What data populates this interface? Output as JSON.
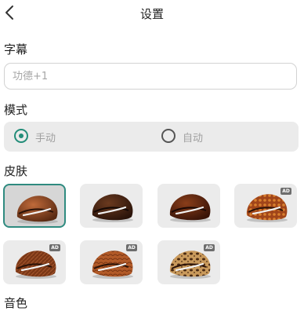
{
  "header": {
    "title": "设置",
    "back_icon": "chevron-left-icon"
  },
  "subtitle_section": {
    "label": "字幕",
    "placeholder": "功德+1"
  },
  "mode_section": {
    "label": "模式",
    "options": [
      {
        "label": "手动",
        "checked": true
      },
      {
        "label": "自动",
        "checked": false
      }
    ]
  },
  "skin_section": {
    "label": "皮肤",
    "skins": [
      {
        "name": "classic-brown",
        "selected": true,
        "badge": ""
      },
      {
        "name": "dark-wood",
        "selected": false,
        "badge": ""
      },
      {
        "name": "mahogany",
        "selected": false,
        "badge": ""
      },
      {
        "name": "orange-pattern",
        "selected": false,
        "badge": "AD"
      },
      {
        "name": "woven-brown",
        "selected": false,
        "badge": "AD"
      },
      {
        "name": "scaled-amber",
        "selected": false,
        "badge": "AD"
      },
      {
        "name": "leopard",
        "selected": false,
        "badge": "AD"
      }
    ]
  },
  "sound_section": {
    "label": "音色"
  },
  "colors": {
    "accent": "#238d79",
    "selected_border": "#2f8b80",
    "panel": "#ebebeb"
  }
}
